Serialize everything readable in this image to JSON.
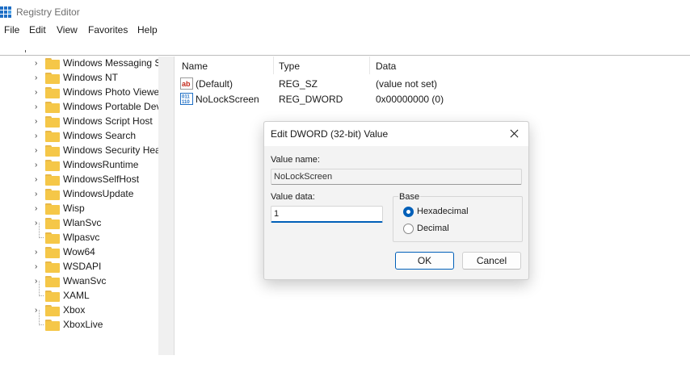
{
  "window": {
    "title": "Registry Editor",
    "icon": "registry-editor-icon"
  },
  "menu": [
    "File",
    "Edit",
    "View",
    "Favorites",
    "Help"
  ],
  "tree": {
    "items": [
      {
        "label": "Windows Messaging S",
        "expandable": true
      },
      {
        "label": "Windows NT",
        "expandable": true
      },
      {
        "label": "Windows Photo Viewe",
        "expandable": true
      },
      {
        "label": "Windows Portable Dev",
        "expandable": true
      },
      {
        "label": "Windows Script Host",
        "expandable": true
      },
      {
        "label": "Windows Search",
        "expandable": true
      },
      {
        "label": "Windows Security Hea",
        "expandable": true
      },
      {
        "label": "WindowsRuntime",
        "expandable": true
      },
      {
        "label": "WindowsSelfHost",
        "expandable": true
      },
      {
        "label": "WindowsUpdate",
        "expandable": true
      },
      {
        "label": "Wisp",
        "expandable": true
      },
      {
        "label": "WlanSvc",
        "expandable": true
      },
      {
        "label": "Wlpasvc",
        "expandable": false
      },
      {
        "label": "Wow64",
        "expandable": true
      },
      {
        "label": "WSDAPI",
        "expandable": true
      },
      {
        "label": "WwanSvc",
        "expandable": true
      },
      {
        "label": "XAML",
        "expandable": false
      },
      {
        "label": "Xbox",
        "expandable": true
      },
      {
        "label": "XboxLive",
        "expandable": false
      }
    ]
  },
  "list": {
    "columns": [
      "Name",
      "Type",
      "Data"
    ],
    "rows": [
      {
        "name": "(Default)",
        "type": "REG_SZ",
        "data": "(value not set)",
        "icon": "string-value-icon"
      },
      {
        "name": "NoLockScreen",
        "type": "REG_DWORD",
        "data": "0x00000000 (0)",
        "icon": "binary-value-icon"
      }
    ]
  },
  "dialog": {
    "title": "Edit DWORD (32-bit) Value",
    "value_name_label": "Value name:",
    "value_name": "NoLockScreen",
    "value_data_label": "Value data:",
    "value_data": "1",
    "base_title": "Base",
    "base_options": [
      "Hexadecimal",
      "Decimal"
    ],
    "base_selected": "Hexadecimal",
    "ok_label": "OK",
    "cancel_label": "Cancel"
  },
  "colors": {
    "accent": "#005fb8",
    "folder": "#f5c748",
    "icon_blue": "#1f6fc5",
    "icon_red": "#c42b1c"
  }
}
